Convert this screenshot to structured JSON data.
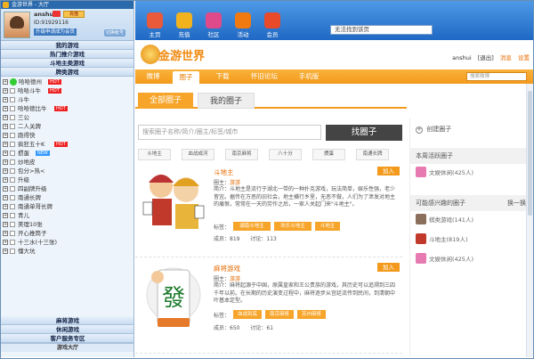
{
  "client": {
    "title": "金游世界 - 大厅",
    "username": "anshui",
    "user_button": "充值",
    "user_id": "ID:91929116",
    "upgrade_link": "升级申请成为会员",
    "rt_label": "切换帐号",
    "sections_top": [
      "我的游戏",
      "热门推介游戏",
      "斗地主类游戏",
      "牌类游戏"
    ],
    "games": [
      {
        "name": "哈哈德州",
        "badge": "HOT",
        "type": "green"
      },
      {
        "name": "哈哈斗牛",
        "badge": "HOT"
      },
      {
        "name": "斗牛"
      },
      {
        "name": "哈哈德比牛",
        "badge": "HOT"
      },
      {
        "name": "三公"
      },
      {
        "name": "二人关牌"
      },
      {
        "name": "跑得快"
      },
      {
        "name": "疯狂五十K",
        "badge": "HOT"
      },
      {
        "name": "掼蛋",
        "badge": "NEW"
      },
      {
        "name": "炒地皮"
      },
      {
        "name": "包分>热<"
      },
      {
        "name": "升级"
      },
      {
        "name": "四副牌升级"
      },
      {
        "name": "南通长牌"
      },
      {
        "name": "南通单哥长牌"
      },
      {
        "name": "青儿"
      },
      {
        "name": "美理10张"
      },
      {
        "name": "开心推筒子"
      },
      {
        "name": "十三水(十三张)"
      },
      {
        "name": "懂大坑"
      }
    ],
    "sections_bottom": [
      "麻将游戏",
      "休闲游戏",
      "客户服务专区"
    ],
    "hall_label": "游戏大厅",
    "toolbar": [
      {
        "label": "主页",
        "icon": "home-icon",
        "color": "#e85a3a"
      },
      {
        "label": "充值",
        "icon": "coin-icon",
        "color": "#f2b21e"
      },
      {
        "label": "社区",
        "icon": "community-icon",
        "color": "#e04a8a"
      },
      {
        "label": "活动",
        "icon": "start-icon",
        "color": "#f07a10"
      },
      {
        "label": "会员",
        "icon": "crown-icon",
        "color": "#e84a2a"
      }
    ],
    "address_text": "无法找到该页"
  },
  "web": {
    "logo_text": "金游世界",
    "top_links": [
      "anshui",
      "[退出]",
      "消息",
      "设置"
    ],
    "nav": [
      "微博",
      "圈子",
      "下载",
      "怀旧论坛",
      "手机版"
    ],
    "nav_selected": 1,
    "nav_search_placeholder": "搜索微博",
    "tabs": [
      "全部圈子",
      "我的圈子"
    ],
    "search_placeholder": "搜索圈子名称/简介/圈主/标签/城市",
    "search_button": "找圈子",
    "categories": [
      "斗地主",
      "血战成河",
      "南京麻将",
      "八十分",
      "掼蛋",
      "南通长牌"
    ],
    "cards": [
      {
        "name": "斗地主",
        "join": "加入",
        "owner_label": "圈主：",
        "owner": "游游",
        "intro": "简介：斗地主是流行于湖北一带的一种扑克游戏，玩法简单，娱乐性强，老少皆宜。据传在万恶的旧社会，地主横行乡里，无恶不做，人们为了泄发对地主的痛恨，常常在一天的劳作之后，一家人关起门来\"斗地主\"。",
        "tags_label": "标签：",
        "tags": [
          "湖南斗地主",
          "欢乐斗地主",
          "斗地主"
        ],
        "members": "成员：819",
        "topics": "讨论：113"
      },
      {
        "name": "麻将游戏",
        "join": "加入",
        "owner_label": "圈主：",
        "owner": "游游",
        "intro": "简介：麻将起源于中国，原属皇家和王公贵族的游戏，其历史可以追溯到三四千年以前。在长期的历史演变过程中，麻将逐步从宫廷流传到民间，到清朝中叶基本定型。",
        "tags_label": "标签：",
        "tags": [
          "血战到底",
          "南京麻将",
          "苏州麻将"
        ],
        "members": "成员：650",
        "topics": "讨论：61"
      }
    ],
    "right": {
      "create": "创建圈子",
      "active_title": "本周活跃圈子",
      "active": [
        {
          "name": "文娱休闲(425人)"
        }
      ],
      "interest_title": "可能感兴趣的圈子",
      "interest_action": "换一换",
      "interest": [
        {
          "name": "棋类游戏(141人)"
        },
        {
          "name": "斗地主(819人)"
        },
        {
          "name": "文娱休闲(425人)"
        }
      ]
    }
  }
}
